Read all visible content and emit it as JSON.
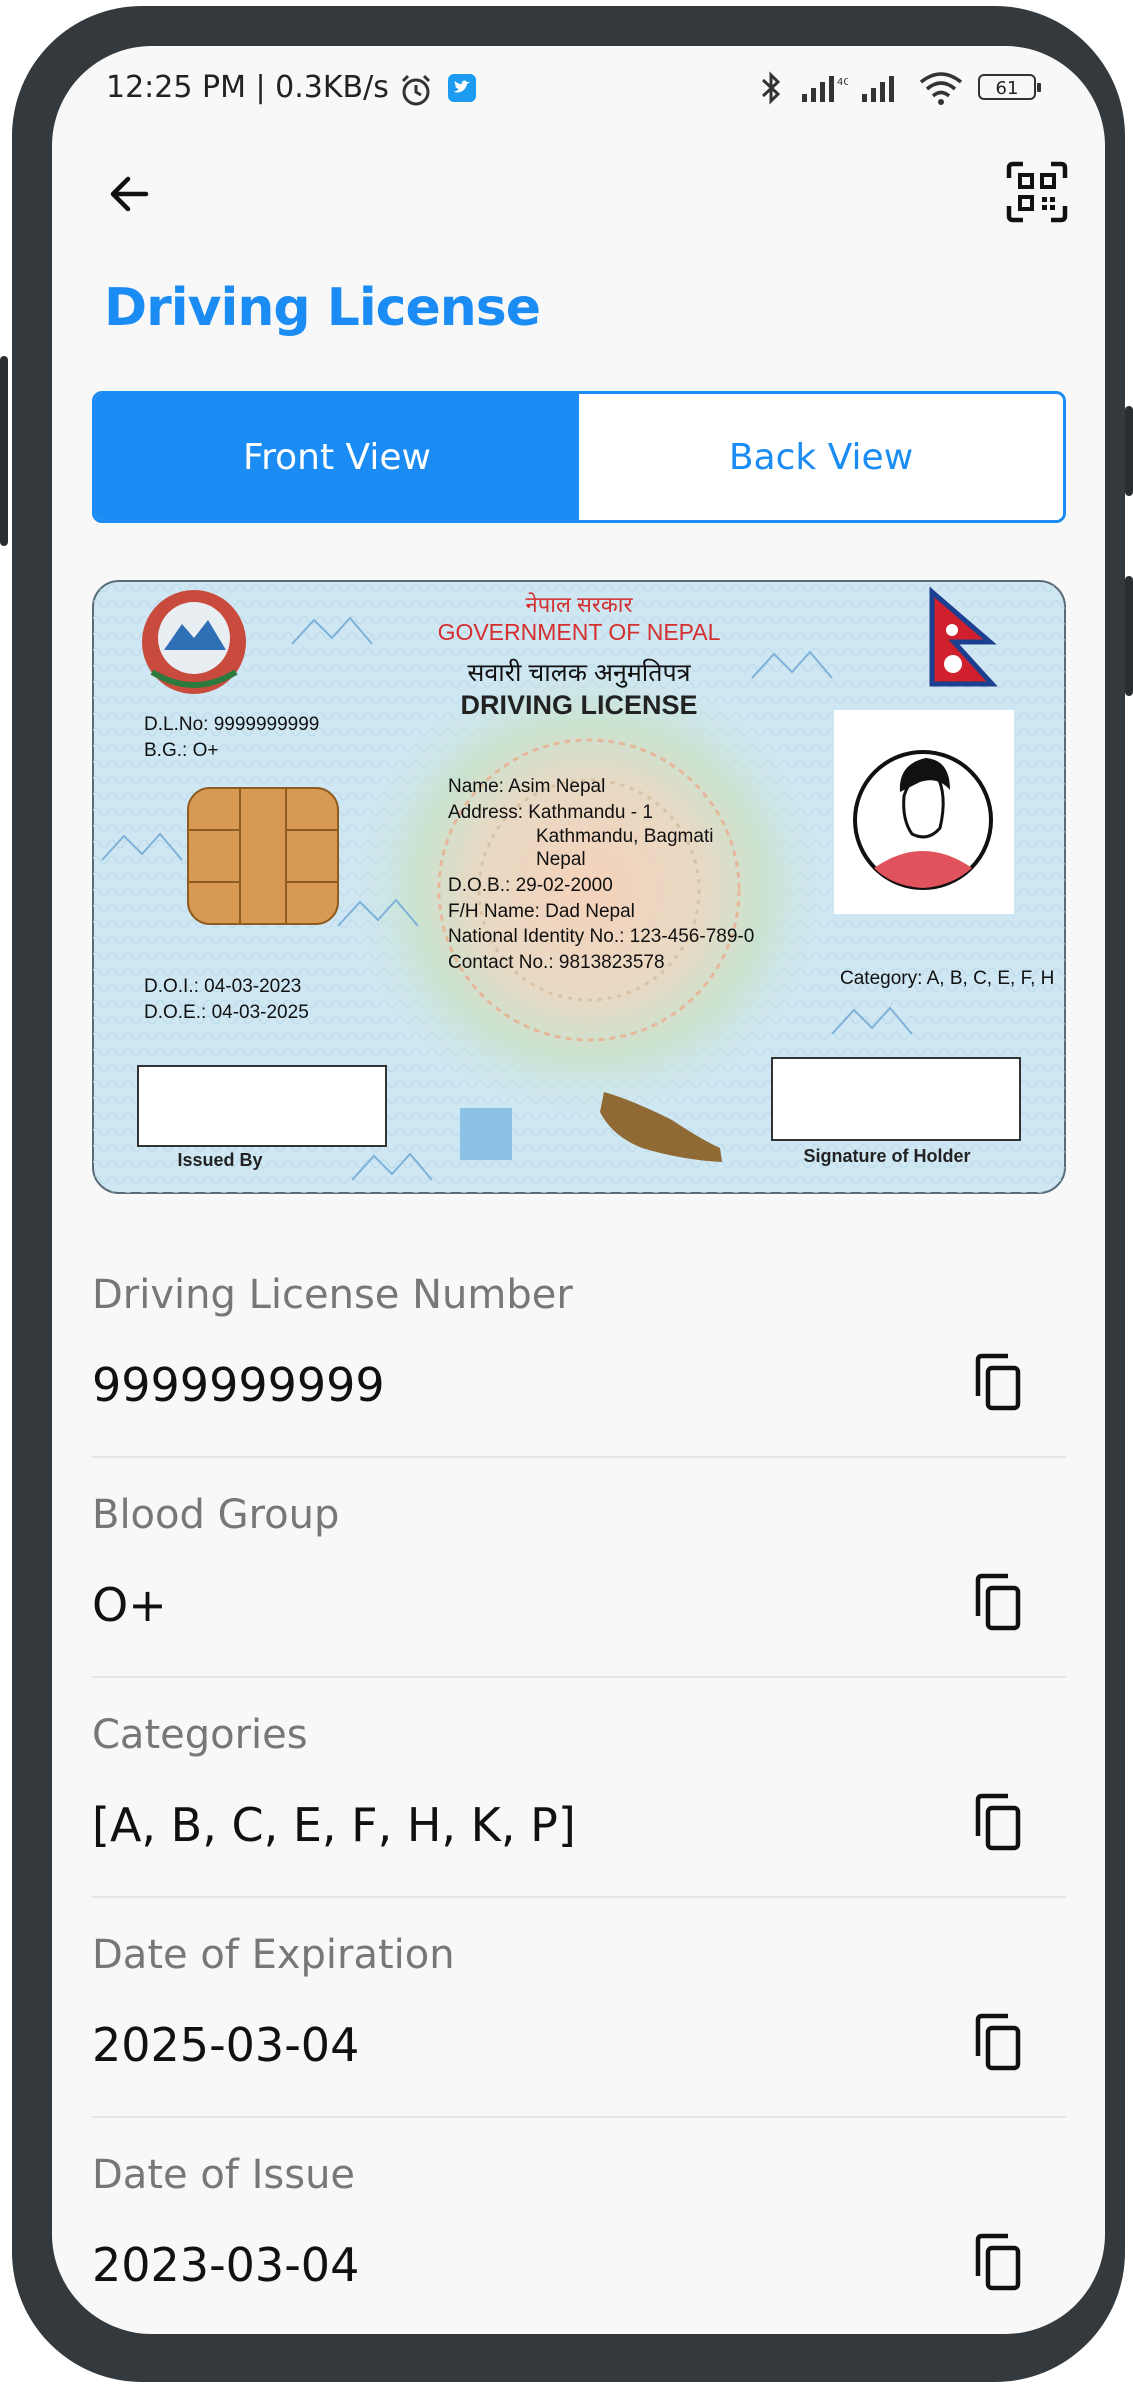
{
  "status_bar": {
    "text": "12:25 PM | 0.3KB/s",
    "battery": "61",
    "icons": [
      "alarm-icon",
      "twitter-icon",
      "bluetooth-icon",
      "signal-icon",
      "signal-icon",
      "wifi-icon",
      "battery-icon"
    ]
  },
  "header": {
    "back_icon": "arrow-left-icon",
    "scan_icon": "qr-scan-icon",
    "title": "Driving License"
  },
  "tabs": [
    {
      "label": "Front View",
      "active": true
    },
    {
      "label": "Back View",
      "active": false
    }
  ],
  "card": {
    "nepali_gov": "नेपाल सरकार",
    "gov": "GOVERNMENT OF NEPAL",
    "nepali_title": "सवारी चालक अनुमतिपत्र",
    "title": "DRIVING LICENSE",
    "dl_no": "D.L.No: 9999999999",
    "bg": "B.G.: O+",
    "name": "Name: Asim Nepal",
    "address_1": "Address: Kathmandu - 1",
    "address_2": "Kathmandu, Bagmati",
    "address_3": "Nepal",
    "dob": "D.O.B.: 29-02-2000",
    "fh_name": "F/H Name: Dad Nepal",
    "national_id": "National Identity No.: 123-456-789-0",
    "contact": "Contact No.: 9813823578",
    "doi": "D.O.I.: 04-03-2023",
    "doe": "D.O.E.: 04-03-2025",
    "category": "Category: A, B, C, E, F, H",
    "issued_by": "Issued By",
    "signature": "Signature of Holder",
    "colors": {
      "card_bg": "#cfe7f3",
      "gov_red": "#d32f2f",
      "chip": "#d89a52"
    }
  },
  "fields": [
    {
      "label": "Driving License Number",
      "value": "9999999999"
    },
    {
      "label": "Blood Group",
      "value": "O+"
    },
    {
      "label": "Categories",
      "value": "[A, B, C, E, F, H, K, P]"
    },
    {
      "label": "Date of Expiration",
      "value": "2025-03-04"
    },
    {
      "label": "Date of Issue",
      "value": "2023-03-04"
    }
  ],
  "accent": "#1a8cf3"
}
